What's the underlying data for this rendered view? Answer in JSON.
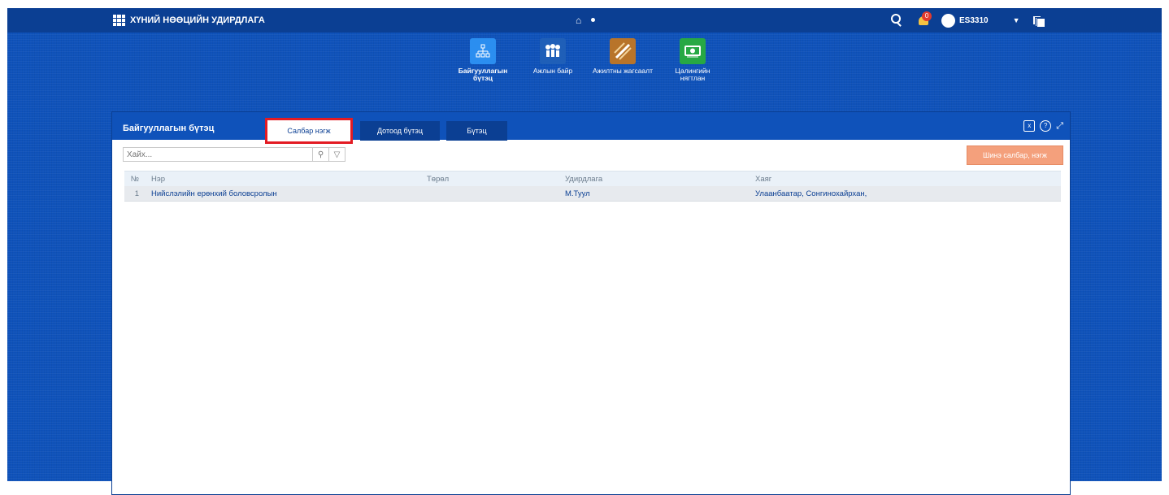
{
  "app": {
    "title": "ХҮНИЙ НӨӨЦИЙН УДИРДЛАГА"
  },
  "topbar": {
    "notification_count": "0",
    "username": "ES3310",
    "home_icon": "home-icon"
  },
  "modules": [
    {
      "label": "Байгууллагын бүтэц",
      "icon": "org-chart-icon",
      "color": "#2b8ef0"
    },
    {
      "label": "Ажлын байр",
      "icon": "people-icon",
      "color": "#1f5fb8"
    },
    {
      "label": "Ажилтны жагсаалт",
      "icon": "employee-list-icon",
      "color": "#b8742a"
    },
    {
      "label": "Цалингийн нягтлан",
      "icon": "money-icon",
      "color": "#27a844"
    }
  ],
  "panel": {
    "title": "Байгууллагын бүтэц",
    "tabs": [
      {
        "label": "Салбар нэгж"
      },
      {
        "label": "Дотоод бүтэц"
      },
      {
        "label": "Бүтэц"
      }
    ],
    "search_placeholder": "Хайх...",
    "new_button": "Шинэ салбар, нэгж"
  },
  "table": {
    "headers": [
      "№",
      "Нэр",
      "Төрөл",
      "Удирдлага",
      "Хаяг"
    ],
    "rows": [
      [
        "1",
        "Нийслэлийн ерөнхий боловсролын",
        "",
        "М.Туул",
        "Улаанбаатар, Сонгинохайрхан,"
      ]
    ]
  },
  "colors": {
    "background": "#0f52ba",
    "topbar": "#0b3f93",
    "highlight": "#e31b23",
    "new_button": "#f4a07c"
  }
}
